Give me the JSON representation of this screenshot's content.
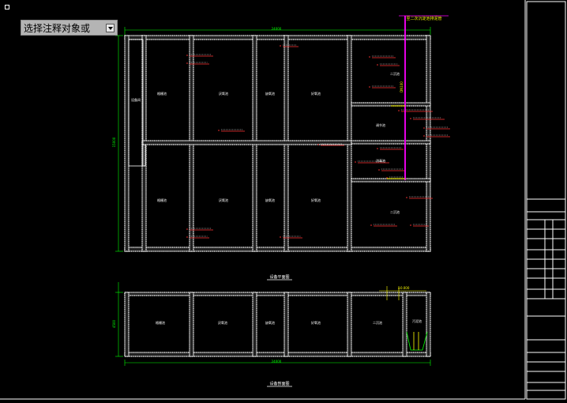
{
  "prompt": {
    "text": "选择注释对象或"
  },
  "drawing": {
    "plan_title": "设备平面图",
    "section_title": "设备剖面图",
    "dim_width": "24000",
    "dim_height": "15000",
    "dim_section_height": "4500",
    "dim_section_width": "24000",
    "pipe_label": "至二次沉淀池排泥管",
    "pipe_vertical_label": "DN100",
    "room_labels": [
      "格栅池",
      "厌氧池",
      "缺氧池",
      "好氧池",
      "二沉池",
      "调节池",
      "污泥池",
      "设备间",
      "消毒池"
    ],
    "section_labels": [
      "格栅池",
      "厌氧池",
      "缺氧池",
      "好氧池",
      "二沉池",
      "污泥池"
    ],
    "elev_label": "±0.000"
  },
  "colors": {
    "background": "#000000",
    "wall": "#ffffff",
    "dimension": "#00ff00",
    "pipe": "#ff00ff",
    "annotation": "#ff3333",
    "text": "#ffff00"
  }
}
